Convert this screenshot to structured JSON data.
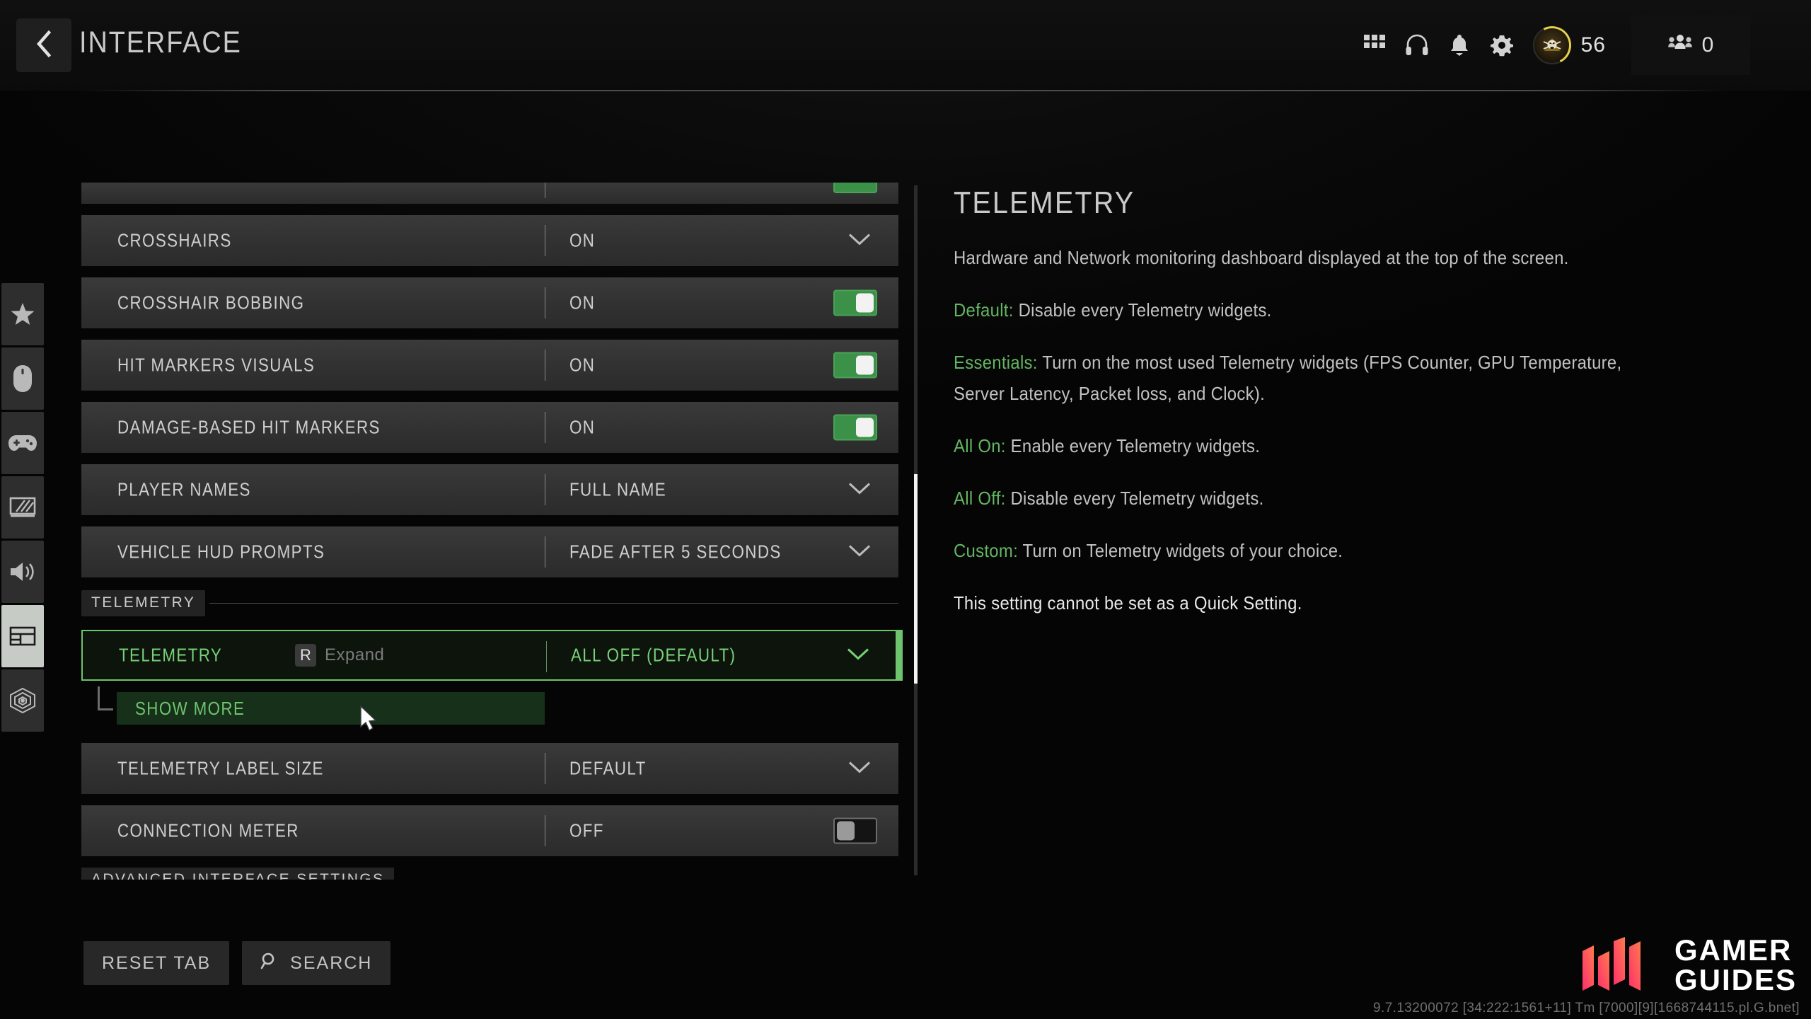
{
  "header": {
    "title": "INTERFACE",
    "back_icon": "chevron-left-icon",
    "icons": [
      {
        "name": "grid-apps-icon",
        "label": "Apps"
      },
      {
        "name": "headset-icon",
        "label": "Audio Chat"
      },
      {
        "name": "bell-icon",
        "label": "Notifications"
      },
      {
        "name": "gear-icon",
        "label": "Settings"
      }
    ],
    "rank": {
      "icon": "skull-emblem-icon",
      "value": "56"
    },
    "party": {
      "icon": "squad-icon",
      "count": "0"
    }
  },
  "sidebar": {
    "items": [
      {
        "icon": "star-icon",
        "name": "favorites",
        "active": false
      },
      {
        "icon": "mouse-icon",
        "name": "keyboard-mouse",
        "active": false
      },
      {
        "icon": "gamepad-icon",
        "name": "controller",
        "active": false
      },
      {
        "icon": "monitor-icon",
        "name": "graphics",
        "active": false
      },
      {
        "icon": "speaker-icon",
        "name": "audio",
        "active": false
      },
      {
        "icon": "interface-panels-icon",
        "name": "interface",
        "active": true
      },
      {
        "icon": "radar-icon",
        "name": "account-network",
        "active": false
      }
    ]
  },
  "settings": {
    "partial_top_row": {
      "type": "toggle",
      "state": "on"
    },
    "rows": [
      {
        "label": "CROSSHAIRS",
        "value": "ON",
        "control": "dropdown"
      },
      {
        "label": "CROSSHAIR BOBBING",
        "value": "ON",
        "control": "toggle",
        "state": "on"
      },
      {
        "label": "HIT MARKERS VISUALS",
        "value": "ON",
        "control": "toggle",
        "state": "on"
      },
      {
        "label": "DAMAGE-BASED HIT MARKERS",
        "value": "ON",
        "control": "toggle",
        "state": "on"
      },
      {
        "label": "PLAYER NAMES",
        "value": "FULL NAME",
        "control": "dropdown"
      },
      {
        "label": "VEHICLE HUD PROMPTS",
        "value": "FADE AFTER 5 SECONDS",
        "control": "dropdown"
      }
    ],
    "section_header": "TELEMETRY",
    "selected_row": {
      "label": "TELEMETRY",
      "value": "ALL OFF (DEFAULT)",
      "control": "dropdown",
      "keycap": "R",
      "keyhint": "Expand"
    },
    "show_more": "SHOW MORE",
    "rows_after": [
      {
        "label": "TELEMETRY LABEL SIZE",
        "value": "DEFAULT",
        "control": "dropdown"
      },
      {
        "label": "CONNECTION METER",
        "value": "OFF",
        "control": "toggle",
        "state": "off"
      }
    ],
    "bottom_section_header": "ADVANCED INTERFACE SETTINGS"
  },
  "detail": {
    "title": "TELEMETRY",
    "intro": "Hardware and Network monitoring dashboard displayed at the top of the screen.",
    "entries": [
      {
        "key": "Default:",
        "text": " Disable every Telemetry widgets."
      },
      {
        "key": "Essentials:",
        "text": " Turn on the most used Telemetry widgets (FPS Counter, GPU Temperature, Server Latency, Packet loss, and Clock)."
      },
      {
        "key": "All On:",
        "text": " Enable every Telemetry widgets."
      },
      {
        "key": "All Off:",
        "text": " Disable every Telemetry widgets."
      },
      {
        "key": "Custom:",
        "text": " Turn on Telemetry widgets of your choice."
      }
    ],
    "note": "This setting cannot be set as a Quick Setting."
  },
  "footer": {
    "reset_label": "RESET TAB",
    "search_label": "SEARCH",
    "search_icon": "magnifier-icon"
  },
  "watermark": {
    "line1": "GAMER",
    "line2": "GUIDES"
  },
  "version": "9.7.13200072 [34:222:1561+11] Tm [7000][9][1668744115.pl.G.bnet]",
  "colors": {
    "accent_green": "#6ec46e",
    "toggle_on": "#3a9147",
    "row_bg": "#313131",
    "panel_bg": "#060606"
  }
}
